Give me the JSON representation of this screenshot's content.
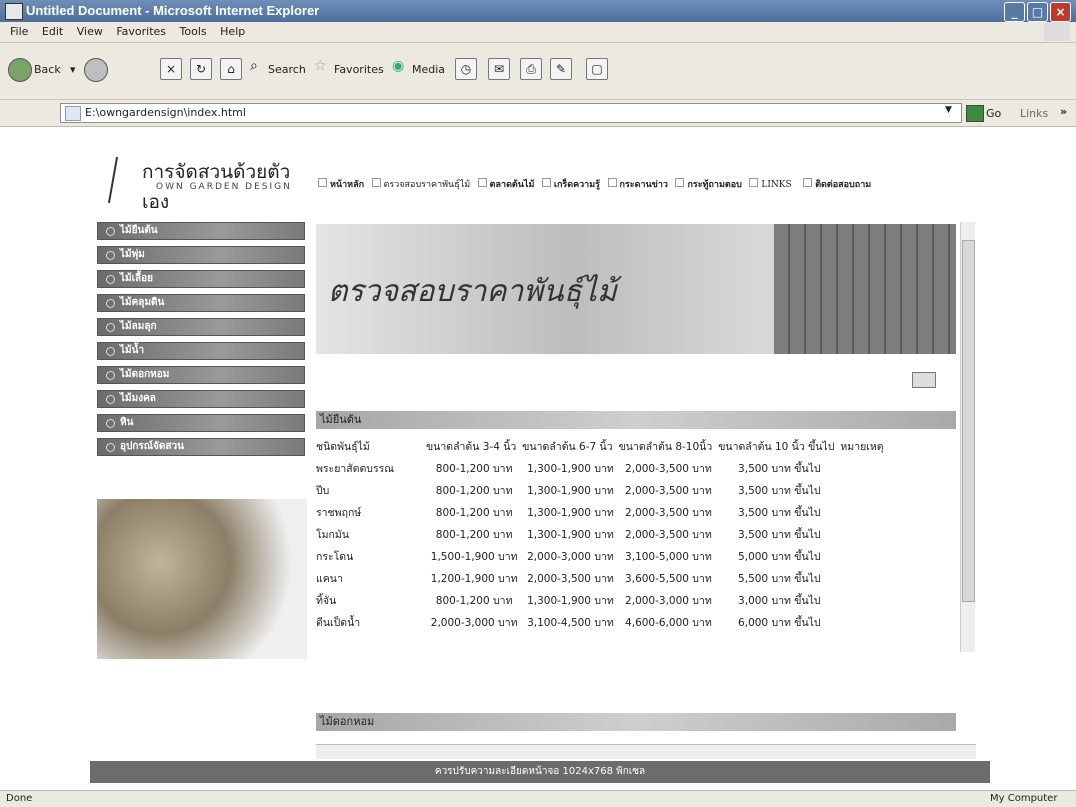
{
  "window": {
    "title": "Untitled Document - Microsoft Internet Explorer"
  },
  "menu": [
    "File",
    "Edit",
    "View",
    "Favorites",
    "Tools",
    "Help"
  ],
  "toolbar": {
    "back": "Back",
    "search": "Search",
    "favorites": "Favorites",
    "media": "Media"
  },
  "address": {
    "url": "E:\\owngardensign\\index.html",
    "go": "Go",
    "links": "Links"
  },
  "site": {
    "brand": "การจัดสวนด้วยตัวเอง",
    "brand_sub": "OWN GARDEN DESIGN",
    "nav": [
      "หน้าหลัก",
      "ตรวจสอบราคาพันธุ์ไม้",
      "ตลาดต้นไม้",
      "เกร็ดความรู้",
      "กระดานข่าว",
      "กระทู้ถามตอบ",
      "LINKS",
      "ติดต่อสอบถาม"
    ]
  },
  "sidebar": [
    "ไม้ยืนต้น",
    "ไม้พุ่ม",
    "ไม้เลื้อย",
    "ไม้คลุมดิน",
    "ไม้ลมลุก",
    "ไม้น้ำ",
    "ไม้ดอกหอม",
    "ไม้มงคล",
    "หิน",
    "อุปกรณ์จัดสวน"
  ],
  "banner": {
    "title": "ตรวจสอบราคาพันธุ์ไม้"
  },
  "section1": {
    "heading": "ไม้ยืนต้น",
    "columns": [
      "ชนิดพันธุ์ไม้",
      "ขนาดลำต้น 3-4 นิ้ว",
      "ขนาดลำต้น 6-7 นิ้ว",
      "ขนาดลำต้น 8-10นิ้ว",
      "ขนาดลำต้น 10 นิ้ว ขึ้นไป",
      "หมายเหตุ"
    ],
    "rows": [
      [
        "พระยาสัตตบรรณ",
        "800-1,200 บาท",
        "1,300-1,900 บาท",
        "2,000-3,500 บาท",
        "3,500 บาท ขึ้นไป",
        ""
      ],
      [
        "ปีบ",
        "800-1,200 บาท",
        "1,300-1,900 บาท",
        "2,000-3,500 บาท",
        "3,500 บาท ขึ้นไป",
        ""
      ],
      [
        "ราชพฤกษ์",
        "800-1,200 บาท",
        "1,300-1,900 บาท",
        "2,000-3,500 บาท",
        "3,500 บาท ขึ้นไป",
        ""
      ],
      [
        "โมกมัน",
        "800-1,200 บาท",
        "1,300-1,900 บาท",
        "2,000-3,500 บาท",
        "3,500 บาท ขึ้นไป",
        ""
      ],
      [
        "กระโดน",
        "1,500-1,900 บาท",
        "2,000-3,000 บาท",
        "3,100-5,000 บาท",
        "5,000 บาท ขึ้นไป",
        ""
      ],
      [
        "แคนา",
        "1,200-1,900 บาท",
        "2,000-3,500 บาท",
        "3,600-5,500 บาท",
        "5,500 บาท ขึ้นไป",
        ""
      ],
      [
        "ทิ้จัน",
        "800-1,200 บาท",
        "1,300-1,900 บาท",
        "2,000-3,000 บาท",
        "3,000 บาท ขึ้นไป",
        ""
      ],
      [
        "ตีนเป็ดน้ำ",
        "2,000-3,000 บาท",
        "3,100-4,500 บาท",
        "4,600-6,000 บาท",
        "6,000 บาท ขึ้นไป",
        ""
      ]
    ]
  },
  "section2": {
    "heading": "ไม้ดอกหอม"
  },
  "footer": {
    "note": "ควรปรับความละเอียดหน้าจอ 1024x768 พิกเซล"
  },
  "status": {
    "left": "Done",
    "right": "My Computer"
  }
}
